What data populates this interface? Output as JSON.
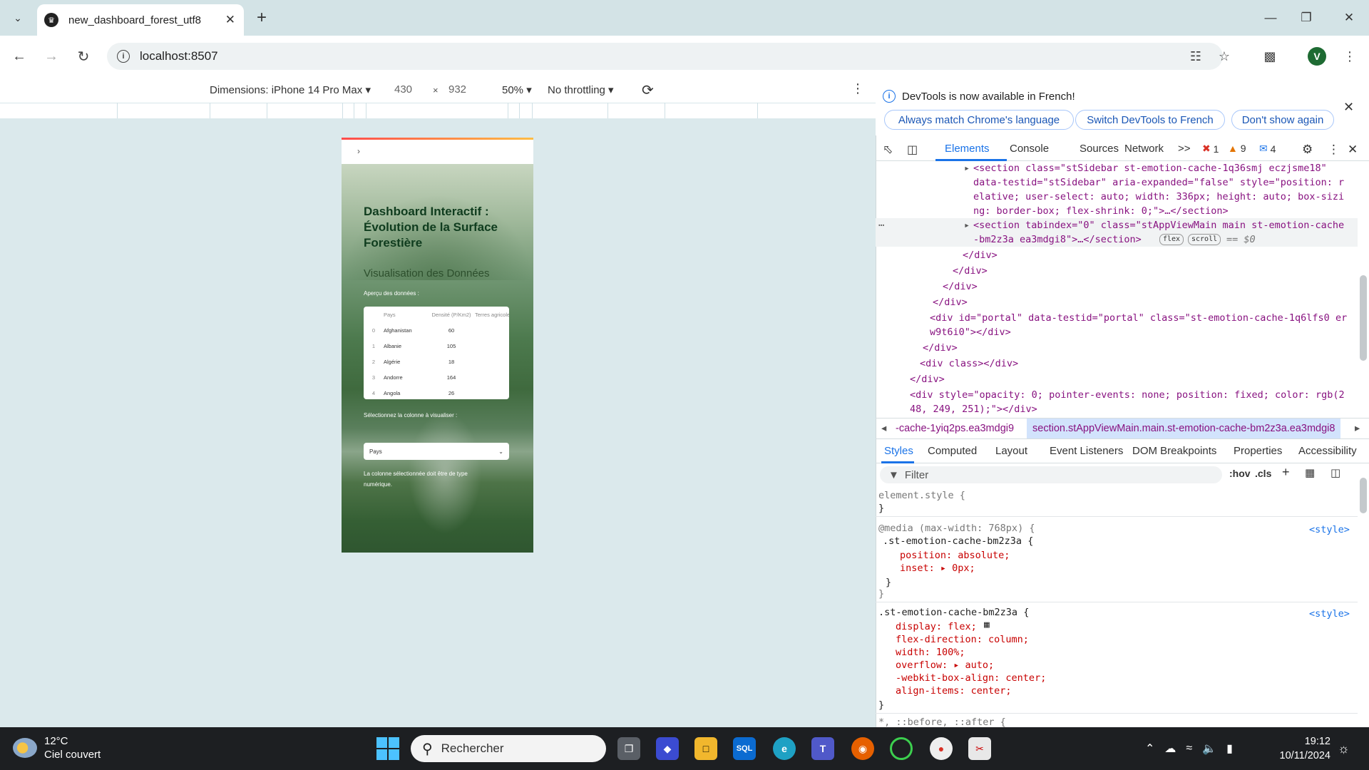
{
  "browser": {
    "tab_title": "new_dashboard_forest_utf8",
    "address": "localhost:8507",
    "profile_initial": "V"
  },
  "device_toolbar": {
    "dimensions_label": "Dimensions: iPhone 14 Pro Max",
    "width": "430",
    "times": "×",
    "height": "932",
    "zoom": "50%",
    "throttling": "No throttling"
  },
  "app": {
    "title": "Dashboard Interactif : Évolution de la Surface Forestière",
    "section_title": "Visualisation des Données",
    "preview_label": "Aperçu des données :",
    "table": {
      "headers": [
        "",
        "Pays",
        "Densité (P/Km2)",
        "Terres agricoles"
      ],
      "rows": [
        [
          "0",
          "Afghanistan",
          "60",
          ""
        ],
        [
          "1",
          "Albanie",
          "105",
          ""
        ],
        [
          "2",
          "Algérie",
          "18",
          ""
        ],
        [
          "3",
          "Andorre",
          "164",
          ""
        ],
        [
          "4",
          "Angola",
          "26",
          ""
        ]
      ]
    },
    "select_label": "Sélectionnez la colonne à visualiser :",
    "select_value": "Pays",
    "warning": "La colonne sélectionnée doit être de type numérique."
  },
  "devtools": {
    "notice": "DevTools is now available in French!",
    "btn_match": "Always match Chrome's language",
    "btn_switch": "Switch DevTools to French",
    "btn_dont": "Don't show again",
    "tabs": [
      "Elements",
      "Console",
      "Sources",
      "Network"
    ],
    "more_tabs": ">>",
    "errors": "1",
    "warnings": "9",
    "messages": "4",
    "breadcrumb_prev": "-cache-1yiq2ps.ea3mdgi9",
    "breadcrumb_current": "section.stAppViewMain.main.st-emotion-cache-bm2z3a.ea3mdgi8",
    "style_tabs": [
      "Styles",
      "Computed",
      "Layout",
      "Event Listeners",
      "DOM Breakpoints",
      "Properties",
      "Accessibility"
    ],
    "filter_placeholder": "Filter",
    "hov": ":hov",
    "cls": ".cls",
    "dom_lines": [
      "<section class=\"stSidebar st-emotion-cache-1q36smj eczjsme18\"",
      "data-testid=\"stSidebar\" aria-expanded=\"false\" style=\"position: r",
      "elative; user-select: auto; width: 336px; height: auto; box-sizi",
      "ng: border-box; flex-shrink: 0;\">…</section>",
      "<section tabindex=\"0\" class=\"stAppViewMain main st-emotion-cache",
      "-bm2z3a ea3mdgi8\">…</section>",
      "</div>",
      "</div>",
      "</div>",
      "</div>",
      "<div id=\"portal\" data-testid=\"portal\" class=\"st-emotion-cache-1q6lfs0 er",
      "w9t6i0\"></div>",
      "</div>",
      "<div class></div>",
      "</div>",
      "<div style=\"opacity: 0; pointer-events: none; position: fixed; color: rgb(2",
      "48, 249, 251);\"></div>"
    ],
    "dom_badges": [
      "flex",
      "scroll"
    ],
    "dom_selected_marker": "== $0",
    "style_lines": [
      "element.style {",
      "}",
      "@media (max-width: 768px) {",
      ".st-emotion-cache-bm2z3a {",
      "position: absolute;",
      "inset: ▸ 0px;",
      "}",
      "}",
      ".st-emotion-cache-bm2z3a {",
      "display: flex;",
      "flex-direction: column;",
      "width: 100%;",
      "overflow: ▸ auto;",
      "-webkit-box-align: center;",
      "align-items: center;",
      "}",
      "*, ::before, ::after {"
    ],
    "style_source": "<style>"
  },
  "taskbar": {
    "temp": "12°C",
    "weather": "Ciel couvert",
    "search": "Rechercher",
    "time": "19:12",
    "date": "10/11/2024"
  }
}
